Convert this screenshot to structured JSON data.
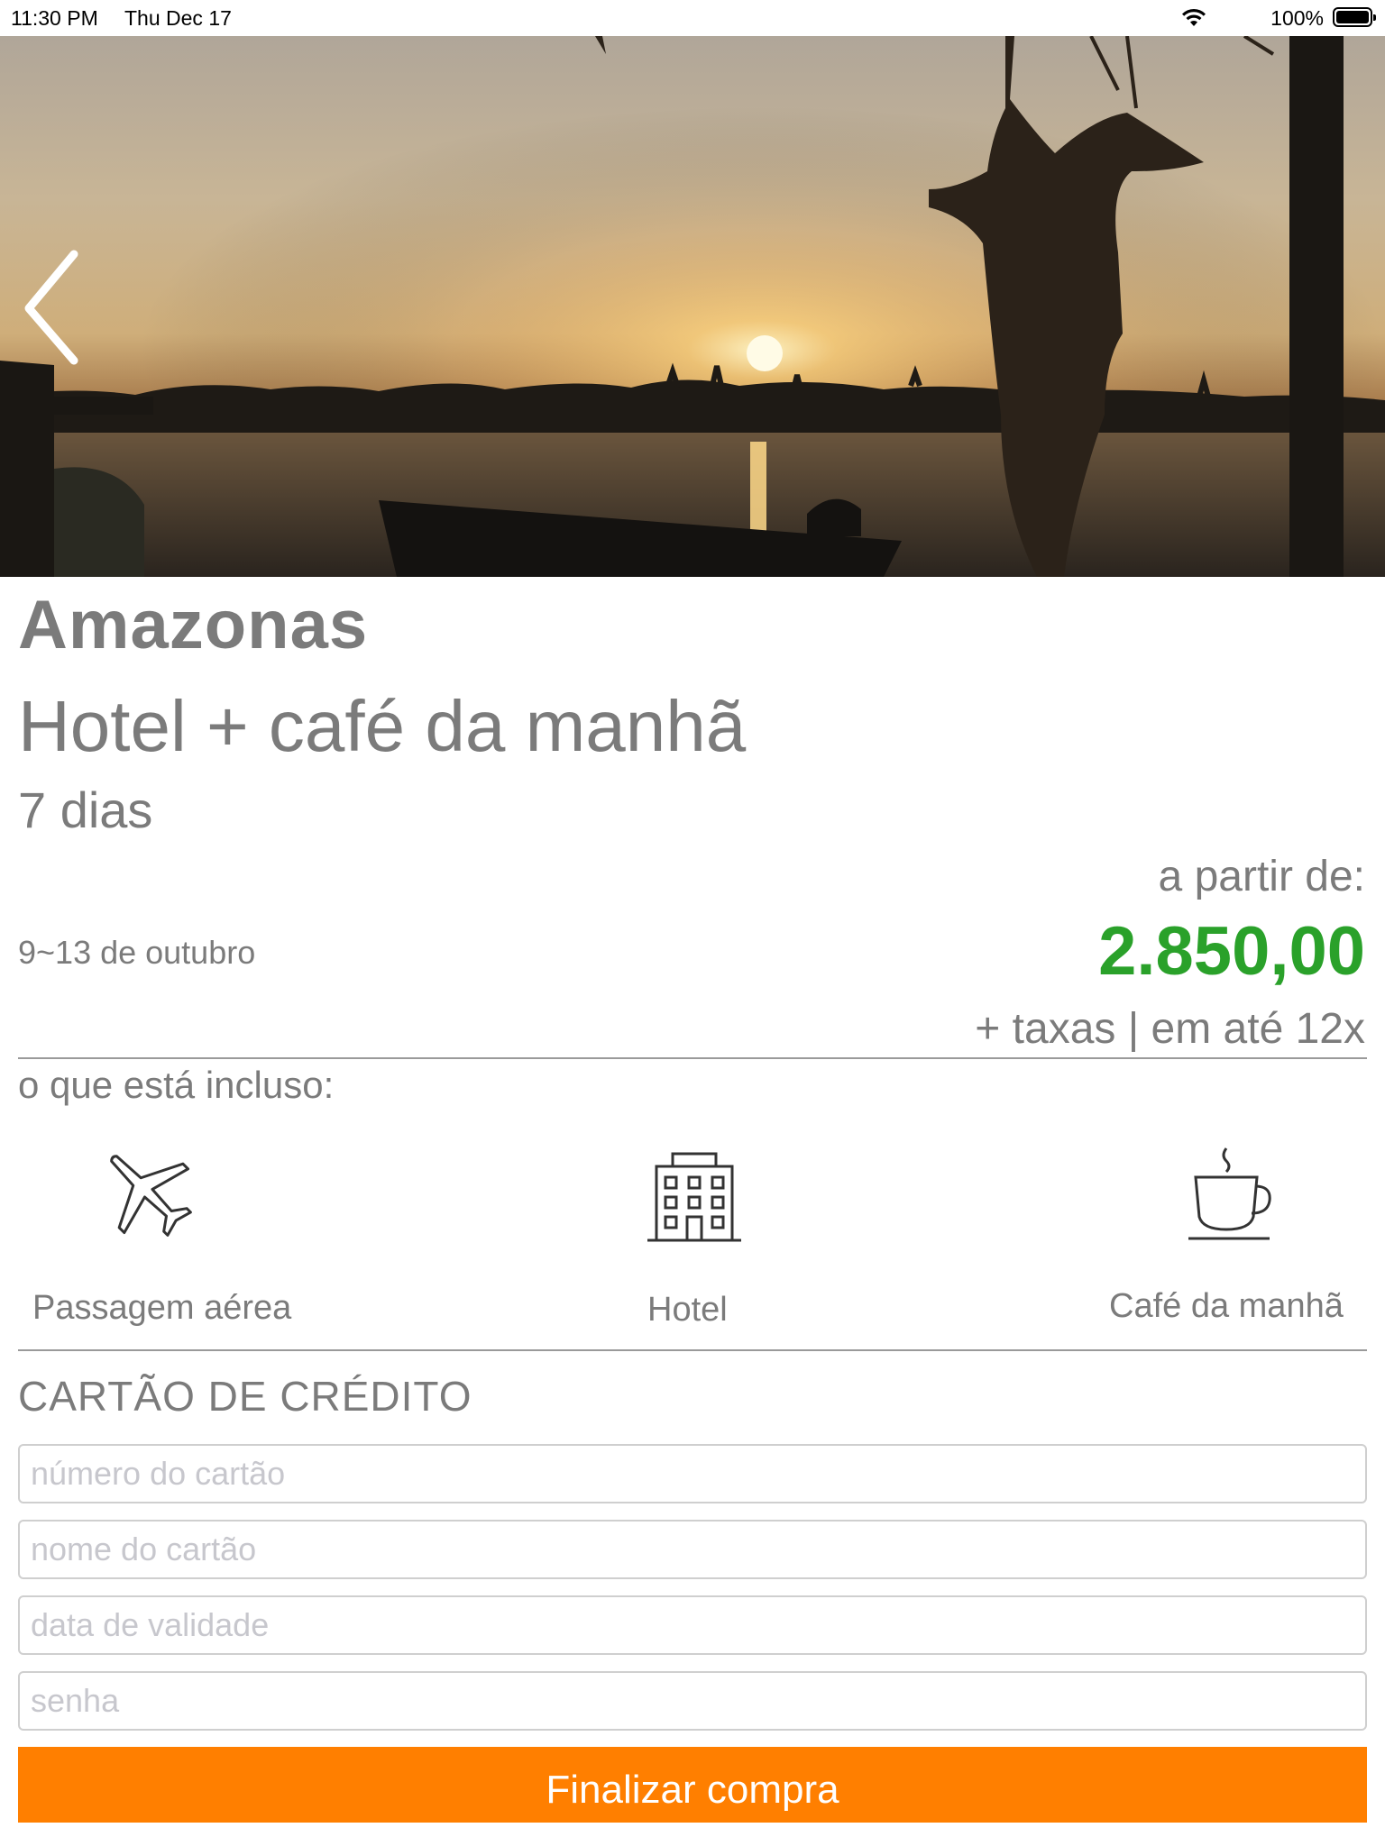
{
  "status_bar": {
    "time": "11:30 PM",
    "date": "Thu Dec 17",
    "battery": "100%"
  },
  "hero": {
    "back_icon": "chevron-left-icon"
  },
  "package": {
    "destination": "Amazonas",
    "type": "Hotel + café da manhã",
    "duration": "7 dias",
    "dates": "9~13 de outubro",
    "price_prefix": "a partir de:",
    "price": "2.850,00",
    "price_suffix": "+ taxas | em até 12x",
    "price_color": "#2aa12a"
  },
  "included": {
    "label": "o que está incluso:",
    "items": [
      {
        "label": "Passagem aérea",
        "icon": "airplane-icon"
      },
      {
        "label": "Hotel",
        "icon": "hotel-building-icon"
      },
      {
        "label": "Café da manhã",
        "icon": "coffee-cup-icon"
      }
    ]
  },
  "credit_card": {
    "title": "CARTÃO DE CRÉDITO",
    "fields": {
      "number_placeholder": "número do cartão",
      "name_placeholder": "nome do cartão",
      "expiry_placeholder": "data de validade",
      "password_placeholder": "senha"
    }
  },
  "submit": {
    "label": "Finalizar compra",
    "color": "#ff7f00"
  }
}
